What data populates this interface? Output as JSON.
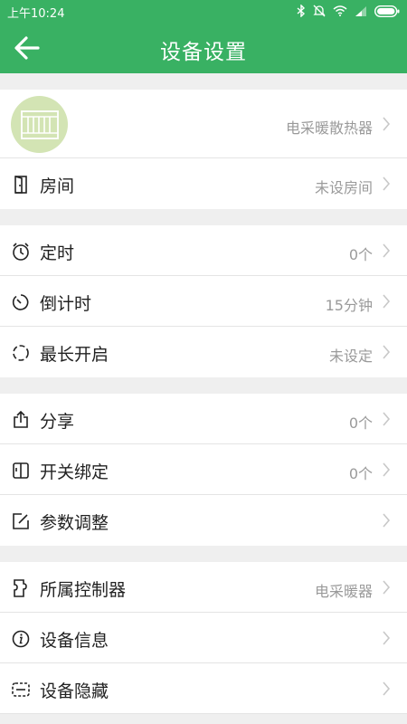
{
  "status_bar": {
    "time": "上午10:24"
  },
  "header": {
    "title": "设备设置"
  },
  "device": {
    "name": "电采暖散热器"
  },
  "room": {
    "label": "房间",
    "value": "未设房间"
  },
  "timer": {
    "label": "定时",
    "value": "0个"
  },
  "countdown": {
    "label": "倒计时",
    "value": "15分钟"
  },
  "max_on": {
    "label": "最长开启",
    "value": "未设定"
  },
  "share": {
    "label": "分享",
    "value": "0个"
  },
  "switch_bind": {
    "label": "开关绑定",
    "value": "0个"
  },
  "params": {
    "label": "参数调整",
    "value": ""
  },
  "controller": {
    "label": "所属控制器",
    "value": "电采暖器"
  },
  "device_info": {
    "label": "设备信息",
    "value": ""
  },
  "device_hide": {
    "label": "设备隐藏",
    "value": ""
  },
  "colors": {
    "primary": "#39b163",
    "avatar_bg": "#d3e4b4",
    "divider": "#e4e4e4",
    "section_gap": "#efefef",
    "value_text": "#9a9a9a"
  }
}
